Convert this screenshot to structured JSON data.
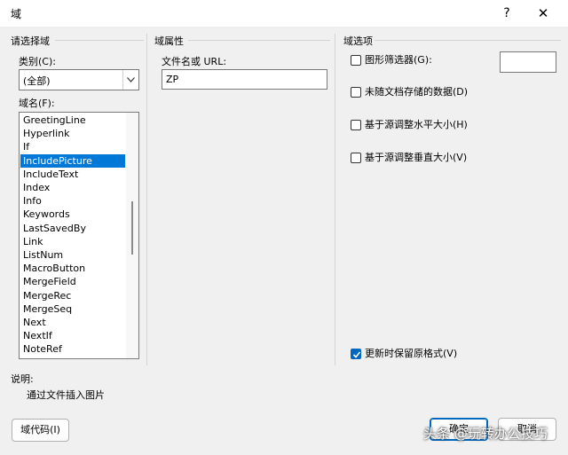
{
  "window": {
    "title": "域",
    "help_label": "?",
    "close_label": "✕"
  },
  "left": {
    "heading": "请选择域",
    "category_label": "类别(C):",
    "category_value": "(全部)",
    "fieldname_label": "域名(F):",
    "fields": [
      "GreetingLine",
      "Hyperlink",
      "If",
      "IncludePicture",
      "IncludeText",
      "Index",
      "Info",
      "Keywords",
      "LastSavedBy",
      "Link",
      "ListNum",
      "MacroButton",
      "MergeField",
      "MergeRec",
      "MergeSeq",
      "Next",
      "NextIf",
      "NoteRef"
    ],
    "selected_index": 3
  },
  "middle": {
    "heading": "域属性",
    "filename_label": "文件名或 URL:",
    "filename_value": "ZP"
  },
  "right": {
    "heading": "域选项",
    "options": [
      {
        "label": "图形筛选器(G):",
        "checked": false
      },
      {
        "label": "未随文档存储的数据(D)",
        "checked": false
      },
      {
        "label": "基于源调整水平大小(H)",
        "checked": false
      },
      {
        "label": "基于源调整垂直大小(V)",
        "checked": false
      }
    ],
    "preserve_format": {
      "label": "更新时保留原格式(V)",
      "checked": true
    }
  },
  "description": {
    "label": "说明:",
    "text": "通过文件插入图片"
  },
  "buttons": {
    "field_codes": "域代码(I)",
    "ok": "确定",
    "cancel": "取消"
  },
  "watermark": "头条 @玩转办公技巧"
}
